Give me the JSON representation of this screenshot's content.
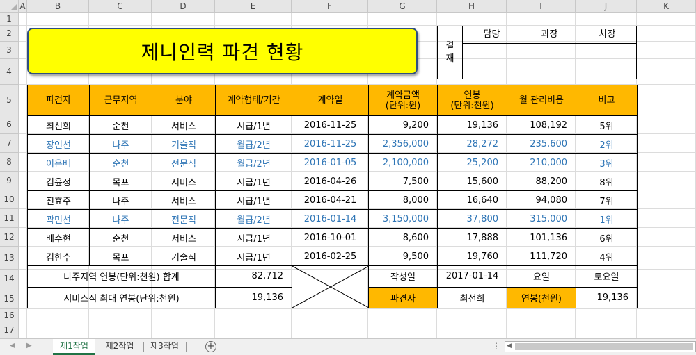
{
  "columns": [
    "A",
    "B",
    "C",
    "D",
    "E",
    "F",
    "G",
    "H",
    "I",
    "J",
    "K"
  ],
  "rows": [
    "1",
    "2",
    "3",
    "4",
    "5",
    "6",
    "7",
    "8",
    "9",
    "10",
    "11",
    "12",
    "13",
    "14",
    "15",
    "16",
    "17"
  ],
  "title": "제니인력 파견 현황",
  "approval": {
    "label": "결\n재",
    "heads": [
      "담당",
      "과장",
      "차장"
    ]
  },
  "table": {
    "headers": [
      "파견자",
      "근무지역",
      "분야",
      "계약형태/기간",
      "계약일",
      "계약금액\n(단위:원)",
      "연봉\n(단위:천원)",
      "월 관리비용",
      "비고"
    ],
    "rows": [
      {
        "blue": false,
        "cells": [
          "최선희",
          "순천",
          "서비스",
          "시급/1년",
          "2016-11-25",
          "9,200",
          "19,136",
          "108,192",
          "5위"
        ]
      },
      {
        "blue": true,
        "cells": [
          "장인선",
          "나주",
          "기술직",
          "월급/2년",
          "2016-11-25",
          "2,356,000",
          "28,272",
          "235,600",
          "2위"
        ]
      },
      {
        "blue": true,
        "cells": [
          "이은배",
          "순천",
          "전문직",
          "월급/2년",
          "2016-01-05",
          "2,100,000",
          "25,200",
          "210,000",
          "3위"
        ]
      },
      {
        "blue": false,
        "cells": [
          "김윤정",
          "목포",
          "서비스",
          "시급/1년",
          "2016-04-26",
          "7,500",
          "15,600",
          "88,200",
          "8위"
        ]
      },
      {
        "blue": false,
        "cells": [
          "진효주",
          "나주",
          "서비스",
          "시급/1년",
          "2016-04-21",
          "8,000",
          "16,640",
          "94,080",
          "7위"
        ]
      },
      {
        "blue": true,
        "cells": [
          "곽민선",
          "나주",
          "전문직",
          "월급/2년",
          "2016-01-14",
          "3,150,000",
          "37,800",
          "315,000",
          "1위"
        ]
      },
      {
        "blue": false,
        "cells": [
          "배수현",
          "순천",
          "서비스",
          "시급/1년",
          "2016-10-01",
          "8,600",
          "17,888",
          "101,136",
          "6위"
        ]
      },
      {
        "blue": false,
        "cells": [
          "김한수",
          "목포",
          "기술직",
          "시급/1년",
          "2016-02-25",
          "9,500",
          "19,760",
          "111,720",
          "4위"
        ]
      }
    ],
    "summary1": {
      "label": "나주지역 연봉(단위:천원) 합계",
      "value": "82,712",
      "date_label": "작성일",
      "date": "2017-01-14",
      "day_label": "요일",
      "day": "토요일"
    },
    "summary2": {
      "label": "서비스직 최대 연봉(단위:천원)",
      "value": "19,136",
      "who_label": "파견자",
      "who": "최선희",
      "salary_label": "연봉(천원)",
      "salary": "19,136"
    }
  },
  "tabs": [
    "제1작업",
    "제2작업",
    "제3작업"
  ],
  "active_tab": "제1작업",
  "colors": {
    "title_fill": "#ffff00",
    "header_fill": "#ffb800",
    "blue_text": "#2e75b6",
    "excel_green": "#217346"
  }
}
